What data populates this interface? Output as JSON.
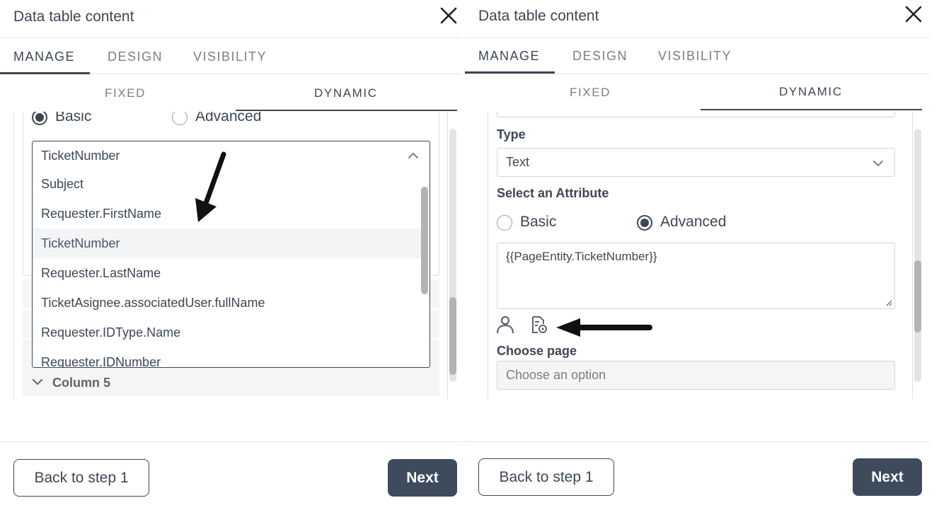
{
  "panels": [
    {
      "title": "Data table content",
      "tabs": [
        "MANAGE",
        "DESIGN",
        "VISIBILITY"
      ],
      "subtabs": [
        "FIXED",
        "DYNAMIC"
      ],
      "attribute_mode": {
        "basic": "Basic",
        "advanced": "Advanced",
        "selected": "Basic"
      },
      "dropdown": {
        "selected": "TicketNumber",
        "options": [
          "Subject",
          "Requester.FirstName",
          "TicketNumber",
          "Requester.LastName",
          "TicketAsignee.associatedUser.fullName",
          "Requester.IDType.Name",
          "Requester.IDNumber"
        ],
        "highlighted": "TicketNumber"
      },
      "column_label": "Column 5",
      "footer": {
        "back_label": "Back to step 1",
        "next_label": "Next"
      }
    },
    {
      "title": "Data table content",
      "tabs": [
        "MANAGE",
        "DESIGN",
        "VISIBILITY"
      ],
      "subtabs": [
        "FIXED",
        "DYNAMIC"
      ],
      "type_label": "Type",
      "type_value": "Text",
      "attribute_label": "Select an Attribute",
      "attribute_mode": {
        "basic": "Basic",
        "advanced": "Advanced",
        "selected": "Advanced"
      },
      "expression": "{{PageEntity.TicketNumber}}",
      "choose_page_label": "Choose page",
      "choose_page_placeholder": "Choose an option",
      "footer": {
        "back_label": "Back to step 1",
        "next_label": "Next"
      }
    }
  ],
  "icons": {
    "close": "close-icon",
    "chevron_up": "chevron-up-icon",
    "chevron_down": "chevron-down-icon",
    "user_attribute": "user-icon",
    "entity_attribute": "document-settings-icon",
    "annotation_arrow": "arrow-annotation-icon"
  },
  "colors": {
    "primary": "#3d4b5c",
    "text": "#3d4754",
    "muted": "#7a7f86",
    "border": "#d6d6d6",
    "highlight": "#f3f4f6"
  }
}
